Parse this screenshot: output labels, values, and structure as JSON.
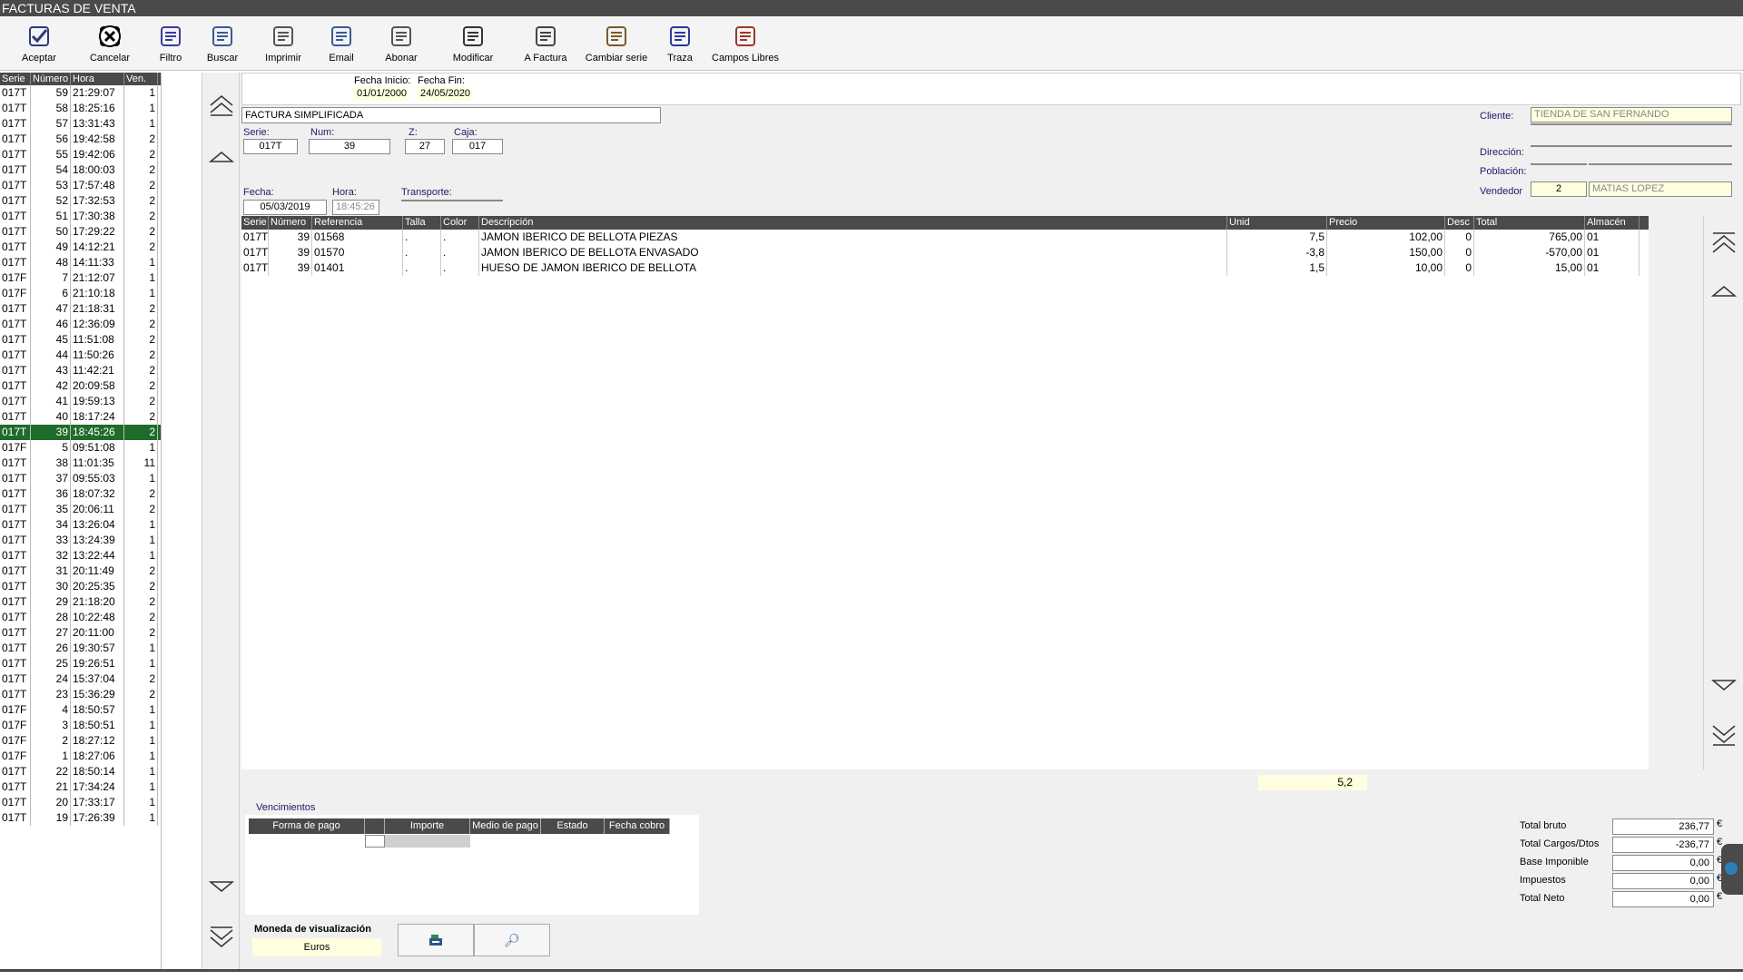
{
  "window": {
    "title": "FACTURAS DE VENTA"
  },
  "toolbar": [
    {
      "label": "Aceptar",
      "icon": "check-icon"
    },
    {
      "label": "Cancelar",
      "icon": "cancel-icon"
    },
    {
      "label": "Filtro",
      "icon": "filter-icon"
    },
    {
      "label": "Buscar",
      "icon": "search-icon"
    },
    {
      "label": "Imprimir",
      "icon": "printer-icon"
    },
    {
      "label": "Email",
      "icon": "email-icon"
    },
    {
      "label": "Abonar",
      "icon": "credit-note-icon"
    },
    {
      "label": "Modificar",
      "icon": "edit-icon"
    },
    {
      "label": "A Factura",
      "icon": "to-invoice-icon"
    },
    {
      "label": "Cambiar serie",
      "icon": "change-series-icon"
    },
    {
      "label": "Traza",
      "icon": "trace-icon"
    },
    {
      "label": "Campos Libres",
      "icon": "free-fields-icon"
    }
  ],
  "left_list": {
    "headers": [
      "Serie",
      "Número",
      "Hora",
      "Ven."
    ],
    "selected_index": 23,
    "rows": [
      [
        "017T",
        "59",
        "21:29:07",
        "1"
      ],
      [
        "017T",
        "58",
        "18:25:16",
        "1"
      ],
      [
        "017T",
        "57",
        "13:31:43",
        "1"
      ],
      [
        "017T",
        "56",
        "19:42:58",
        "2"
      ],
      [
        "017T",
        "55",
        "19:42:06",
        "2"
      ],
      [
        "017T",
        "54",
        "18:00:03",
        "2"
      ],
      [
        "017T",
        "53",
        "17:57:48",
        "2"
      ],
      [
        "017T",
        "52",
        "17:32:53",
        "2"
      ],
      [
        "017T",
        "51",
        "17:30:38",
        "2"
      ],
      [
        "017T",
        "50",
        "17:29:22",
        "2"
      ],
      [
        "017T",
        "49",
        "14:12:21",
        "2"
      ],
      [
        "017T",
        "48",
        "14:11:33",
        "1"
      ],
      [
        "017F",
        "7",
        "21:12:07",
        "1"
      ],
      [
        "017F",
        "6",
        "21:10:18",
        "1"
      ],
      [
        "017T",
        "47",
        "21:18:31",
        "2"
      ],
      [
        "017T",
        "46",
        "12:36:09",
        "2"
      ],
      [
        "017T",
        "45",
        "11:51:08",
        "2"
      ],
      [
        "017T",
        "44",
        "11:50:26",
        "2"
      ],
      [
        "017T",
        "43",
        "11:42:21",
        "2"
      ],
      [
        "017T",
        "42",
        "20:09:58",
        "2"
      ],
      [
        "017T",
        "41",
        "19:59:13",
        "2"
      ],
      [
        "017T",
        "40",
        "18:17:24",
        "2"
      ],
      [
        "017T",
        "39",
        "18:45:26",
        "2"
      ],
      [
        "017F",
        "5",
        "09:51:08",
        "1"
      ],
      [
        "017T",
        "38",
        "11:01:35",
        "11"
      ],
      [
        "017T",
        "37",
        "09:55:03",
        "1"
      ],
      [
        "017T",
        "36",
        "18:07:32",
        "2"
      ],
      [
        "017T",
        "35",
        "20:06:11",
        "2"
      ],
      [
        "017T",
        "34",
        "13:26:04",
        "1"
      ],
      [
        "017T",
        "33",
        "13:24:39",
        "1"
      ],
      [
        "017T",
        "32",
        "13:22:44",
        "1"
      ],
      [
        "017T",
        "31",
        "20:11:49",
        "2"
      ],
      [
        "017T",
        "30",
        "20:25:35",
        "2"
      ],
      [
        "017T",
        "29",
        "21:18:20",
        "2"
      ],
      [
        "017T",
        "28",
        "10:22:48",
        "2"
      ],
      [
        "017T",
        "27",
        "20:11:00",
        "2"
      ],
      [
        "017T",
        "26",
        "19:30:57",
        "1"
      ],
      [
        "017T",
        "25",
        "19:26:51",
        "1"
      ],
      [
        "017T",
        "24",
        "15:37:04",
        "2"
      ],
      [
        "017T",
        "23",
        "15:36:29",
        "2"
      ],
      [
        "017F",
        "4",
        "18:50:57",
        "1"
      ],
      [
        "017F",
        "3",
        "18:50:51",
        "1"
      ],
      [
        "017F",
        "2",
        "18:27:12",
        "1"
      ],
      [
        "017F",
        "1",
        "18:27:06",
        "1"
      ],
      [
        "017T",
        "22",
        "18:50:14",
        "1"
      ],
      [
        "017T",
        "21",
        "17:34:24",
        "1"
      ],
      [
        "017T",
        "20",
        "17:33:17",
        "1"
      ],
      [
        "017T",
        "19",
        "17:26:39",
        "1"
      ]
    ]
  },
  "header": {
    "fecha_inicio_label": "Fecha Inicio:",
    "fecha_inicio": "01/01/2000",
    "fecha_fin_label": "Fecha Fin:",
    "fecha_fin": "24/05/2020",
    "tipo": "FACTURA SIMPLIFICADA",
    "serie_label": "Serie:",
    "serie": "017T",
    "num_label": "Num:",
    "num": "39",
    "z_label": "Z:",
    "z": "27",
    "caja_label": "Caja:",
    "caja": "017",
    "fecha_label": "Fecha:",
    "fecha": "05/03/2019",
    "hora_label": "Hora:",
    "hora": "18:45:26",
    "transporte_label": "Transporte:",
    "transporte": "",
    "cliente_label": "Cliente:",
    "cliente": "TIENDA DE SAN FERNANDO",
    "direccion_label": "Dirección:",
    "direccion": "",
    "poblacion_label": "Población:",
    "poblacion_cp": "",
    "poblacion": "",
    "vendedor_label": "Vendedor",
    "vendedor_num": "2",
    "vendedor": "MATIAS LOPEZ"
  },
  "lines": {
    "headers": [
      "Serie",
      "Número",
      "Referencia",
      "Talla",
      "Color",
      "Descripción",
      "Unid",
      "Precio",
      "Desc",
      "Total",
      "Almacén"
    ],
    "rows": [
      [
        "017T",
        "39",
        "01568",
        ".",
        ".",
        "JAMON IBERICO DE BELLOTA PIEZAS",
        "7,5",
        "102,00",
        "0",
        "765,00",
        "01"
      ],
      [
        "017T",
        "39",
        "01570",
        ".",
        ".",
        "JAMON IBERICO DE BELLOTA ENVASADO",
        "-3,8",
        "150,00",
        "0",
        "-570,00",
        "01"
      ],
      [
        "017T",
        "39",
        "01401",
        ".",
        ".",
        "HUESO DE JAMON IBERICO DE BELLOTA",
        "1,5",
        "10,00",
        "0",
        "15,00",
        "01"
      ]
    ],
    "sum_unid": "5,2"
  },
  "vencimientos": {
    "title": "Vencimientos",
    "headers": [
      "Forma de pago",
      "",
      "Importe",
      "Medio de pago",
      "Estado",
      "Fecha cobro"
    ]
  },
  "moneda": {
    "label": "Moneda de visualización",
    "value": "Euros"
  },
  "totales": [
    {
      "label": "Total bruto",
      "value": "236,77",
      "unit": "€"
    },
    {
      "label": "Total Cargos/Dtos",
      "value": "-236,77",
      "unit": "€"
    },
    {
      "label": "Base Imponible",
      "value": "0,00",
      "unit": "€"
    },
    {
      "label": "Impuestos",
      "value": "0,00",
      "unit": "€"
    },
    {
      "label": "Total Neto",
      "value": "0,00",
      "unit": "€"
    }
  ]
}
